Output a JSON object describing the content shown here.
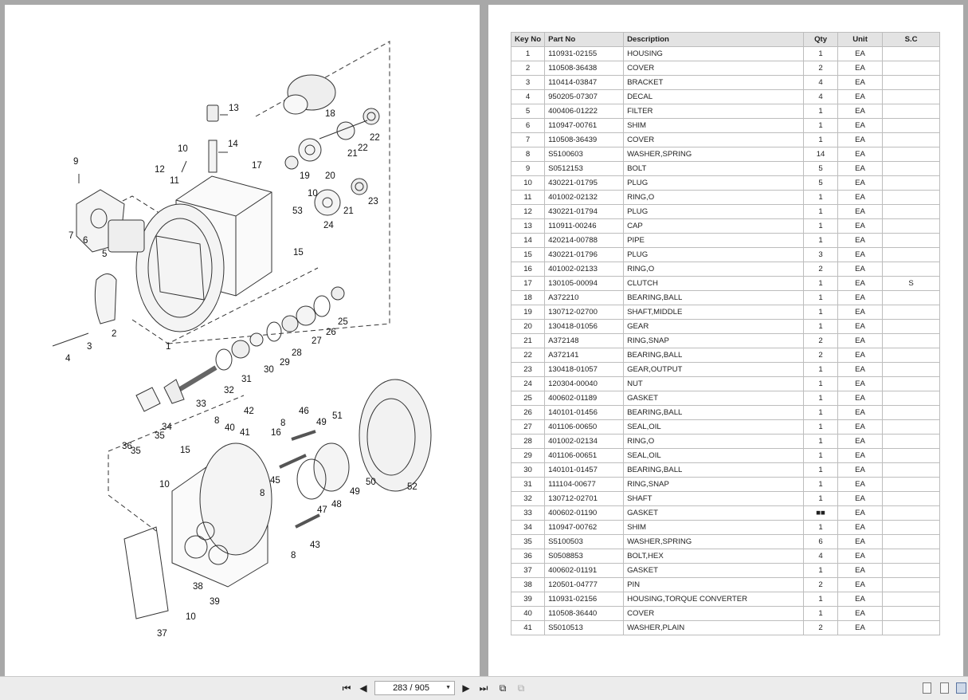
{
  "toolbar": {
    "page_indicator": "283 / 905",
    "icons": [
      "first-page-icon",
      "prev-page-icon",
      "next-page-icon",
      "last-page-icon",
      "rotate-icon",
      "fit-icon",
      "single-page-view-icon",
      "continuous-view-icon",
      "two-page-view-icon"
    ]
  },
  "diagram": {
    "callouts": [
      "1",
      "2",
      "3",
      "4",
      "5",
      "6",
      "7",
      "8",
      "9",
      "10",
      "10",
      "10",
      "10",
      "11",
      "12",
      "13",
      "14",
      "15",
      "15",
      "16",
      "17",
      "18",
      "19",
      "20",
      "21",
      "21",
      "22",
      "22",
      "23",
      "24",
      "25",
      "26",
      "27",
      "28",
      "29",
      "30",
      "31",
      "32",
      "33",
      "34",
      "35",
      "35",
      "36",
      "37",
      "38",
      "39",
      "40",
      "41",
      "42",
      "43",
      "45",
      "46",
      "47",
      "48",
      "49",
      "49",
      "50",
      "51",
      "52",
      "53",
      "8",
      "8",
      "8"
    ]
  },
  "parts_table": {
    "headers": [
      "Key No",
      "Part No",
      "Description",
      "Qty",
      "Unit",
      "S.C"
    ],
    "rows": [
      [
        "1",
        "110931-02155",
        "HOUSING",
        "1",
        "EA",
        ""
      ],
      [
        "2",
        "110508-36438",
        "COVER",
        "2",
        "EA",
        ""
      ],
      [
        "3",
        "110414-03847",
        "BRACKET",
        "4",
        "EA",
        ""
      ],
      [
        "4",
        "950205-07307",
        "DECAL",
        "4",
        "EA",
        ""
      ],
      [
        "5",
        "400406-01222",
        "FILTER",
        "1",
        "EA",
        ""
      ],
      [
        "6",
        "110947-00761",
        "SHIM",
        "1",
        "EA",
        ""
      ],
      [
        "7",
        "110508-36439",
        "COVER",
        "1",
        "EA",
        ""
      ],
      [
        "8",
        "S5100603",
        "WASHER,SPRING",
        "14",
        "EA",
        ""
      ],
      [
        "9",
        "S0512153",
        "BOLT",
        "5",
        "EA",
        ""
      ],
      [
        "10",
        "430221-01795",
        "PLUG",
        "5",
        "EA",
        ""
      ],
      [
        "11",
        "401002-02132",
        "RING,O",
        "1",
        "EA",
        ""
      ],
      [
        "12",
        "430221-01794",
        "PLUG",
        "1",
        "EA",
        ""
      ],
      [
        "13",
        "110911-00246",
        "CAP",
        "1",
        "EA",
        ""
      ],
      [
        "14",
        "420214-00788",
        "PIPE",
        "1",
        "EA",
        ""
      ],
      [
        "15",
        "430221-01796",
        "PLUG",
        "3",
        "EA",
        ""
      ],
      [
        "16",
        "401002-02133",
        "RING,O",
        "2",
        "EA",
        ""
      ],
      [
        "17",
        "130105-00094",
        "CLUTCH",
        "1",
        "EA",
        "S"
      ],
      [
        "18",
        "A372210",
        "BEARING,BALL",
        "1",
        "EA",
        ""
      ],
      [
        "19",
        "130712-02700",
        "SHAFT,MIDDLE",
        "1",
        "EA",
        ""
      ],
      [
        "20",
        "130418-01056",
        "GEAR",
        "1",
        "EA",
        ""
      ],
      [
        "21",
        "A372148",
        "RING,SNAP",
        "2",
        "EA",
        ""
      ],
      [
        "22",
        "A372141",
        "BEARING,BALL",
        "2",
        "EA",
        ""
      ],
      [
        "23",
        "130418-01057",
        "GEAR,OUTPUT",
        "1",
        "EA",
        ""
      ],
      [
        "24",
        "120304-00040",
        "NUT",
        "1",
        "EA",
        ""
      ],
      [
        "25",
        "400602-01189",
        "GASKET",
        "1",
        "EA",
        ""
      ],
      [
        "26",
        "140101-01456",
        "BEARING,BALL",
        "1",
        "EA",
        ""
      ],
      [
        "27",
        "401106-00650",
        "SEAL,OIL",
        "1",
        "EA",
        ""
      ],
      [
        "28",
        "401002-02134",
        "RING,O",
        "1",
        "EA",
        ""
      ],
      [
        "29",
        "401106-00651",
        "SEAL,OIL",
        "1",
        "EA",
        ""
      ],
      [
        "30",
        "140101-01457",
        "BEARING,BALL",
        "1",
        "EA",
        ""
      ],
      [
        "31",
        "111104-00677",
        "RING,SNAP",
        "1",
        "EA",
        ""
      ],
      [
        "32",
        "130712-02701",
        "SHAFT",
        "1",
        "EA",
        ""
      ],
      [
        "33",
        "400602-01190",
        "GASKET",
        "■■",
        "EA",
        ""
      ],
      [
        "34",
        "110947-00762",
        "SHIM",
        "1",
        "EA",
        ""
      ],
      [
        "35",
        "S5100503",
        "WASHER,SPRING",
        "6",
        "EA",
        ""
      ],
      [
        "36",
        "S0508853",
        "BOLT,HEX",
        "4",
        "EA",
        ""
      ],
      [
        "37",
        "400602-01191",
        "GASKET",
        "1",
        "EA",
        ""
      ],
      [
        "38",
        "120501-04777",
        "PIN",
        "2",
        "EA",
        ""
      ],
      [
        "39",
        "110931-02156",
        "HOUSING,TORQUE CONVERTER",
        "1",
        "EA",
        ""
      ],
      [
        "40",
        "110508-36440",
        "COVER",
        "1",
        "EA",
        ""
      ],
      [
        "41",
        "S5010513",
        "WASHER,PLAIN",
        "2",
        "EA",
        ""
      ]
    ]
  }
}
